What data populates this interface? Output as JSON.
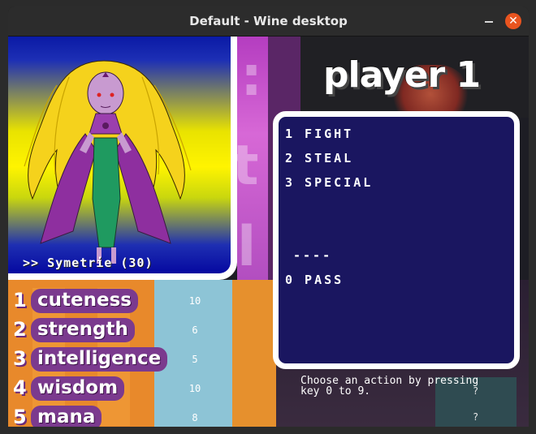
{
  "window": {
    "title": "Default - Wine desktop",
    "close_glyph": "✕"
  },
  "player": {
    "title": "player 1"
  },
  "character": {
    "name": ">> Symetrie (30)"
  },
  "menu": {
    "items": [
      {
        "key": "1",
        "label": "1 FIGHT"
      },
      {
        "key": "2",
        "label": "2 STEAL"
      },
      {
        "key": "3",
        "label": "3 SPECIAL"
      },
      {
        "key": "",
        "label": "----"
      },
      {
        "key": "0",
        "label": "0 PASS"
      }
    ]
  },
  "hint": "Choose an action by pressing key 0 to 9.",
  "unknown_marks": [
    "?",
    "?"
  ],
  "stats": [
    {
      "num": "1",
      "label": "cuteness",
      "value": "10"
    },
    {
      "num": "2",
      "label": "strength",
      "value": "6"
    },
    {
      "num": "3",
      "label": "intelligence",
      "value": "5"
    },
    {
      "num": "4",
      "label": "wisdom",
      "value": "10"
    },
    {
      "num": "5",
      "label": "mana",
      "value": "8"
    }
  ],
  "colors": {
    "menu_bg": "#1a1660",
    "stat_label_bg": "#7b3a8e",
    "close_button": "#e9541f"
  }
}
